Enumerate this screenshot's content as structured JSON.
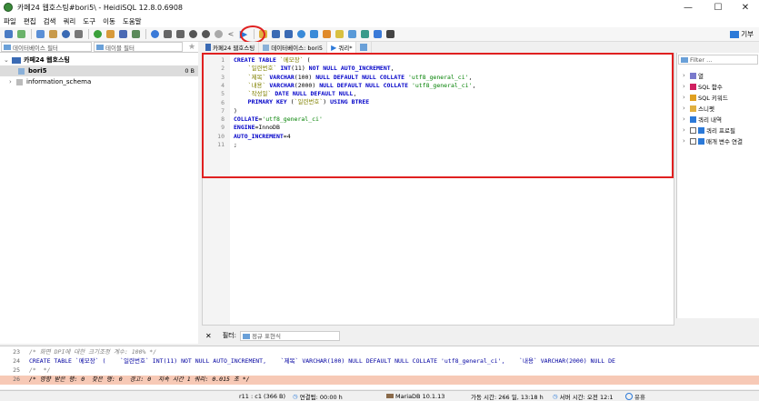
{
  "window": {
    "title": "카페24 웹호스팅#bori5\\ - HeidiSQL 12.8.0.6908",
    "minimize": "—",
    "maximize": "☐",
    "close": "✕"
  },
  "menu": [
    "파일",
    "편집",
    "검색",
    "쿼리",
    "도구",
    "이동",
    "도움말"
  ],
  "help_label": "기부",
  "db_filter_placeholder": "데이터베이스 필터",
  "table_filter_placeholder": "테이블 필터",
  "tree": {
    "root": "카페24 웹호스팅",
    "items": [
      {
        "name": "bori5",
        "size": "0 B",
        "selected": true
      },
      {
        "name": "information_schema",
        "size": "",
        "selected": false
      }
    ]
  },
  "tabs": [
    {
      "label": "카페24 웹호스팅"
    },
    {
      "label": "데이터베이스: bori5"
    },
    {
      "label": "쿼리*"
    }
  ],
  "editor": {
    "line_numbers": [
      "1",
      "2",
      "3",
      "4",
      "5",
      "6",
      "7",
      "8",
      "9",
      "10",
      "11"
    ],
    "lines": [
      [
        {
          "t": "kw",
          "v": "CREATE TABLE "
        },
        {
          "t": "idt",
          "v": "`메모장`"
        },
        {
          "t": "",
          "v": " ("
        }
      ],
      [
        {
          "t": "",
          "v": "    "
        },
        {
          "t": "idt",
          "v": "`일련번호`"
        },
        {
          "t": "",
          "v": " "
        },
        {
          "t": "kw",
          "v": "INT"
        },
        {
          "t": "",
          "v": "(11) "
        },
        {
          "t": "kw",
          "v": "NOT NULL AUTO_INCREMENT"
        },
        {
          "t": "",
          "v": ","
        }
      ],
      [
        {
          "t": "",
          "v": "    "
        },
        {
          "t": "idt",
          "v": "`제목`"
        },
        {
          "t": "",
          "v": " "
        },
        {
          "t": "kw",
          "v": "VARCHAR"
        },
        {
          "t": "",
          "v": "(100) "
        },
        {
          "t": "kw",
          "v": "NULL DEFAULT NULL COLLATE "
        },
        {
          "t": "str",
          "v": "'utf8_general_ci'"
        },
        {
          "t": "",
          "v": ","
        }
      ],
      [
        {
          "t": "",
          "v": "    "
        },
        {
          "t": "idt",
          "v": "`내용`"
        },
        {
          "t": "",
          "v": " "
        },
        {
          "t": "kw",
          "v": "VARCHAR"
        },
        {
          "t": "",
          "v": "(2000) "
        },
        {
          "t": "kw",
          "v": "NULL DEFAULT NULL COLLATE "
        },
        {
          "t": "str",
          "v": "'utf8_general_ci'"
        },
        {
          "t": "",
          "v": ","
        }
      ],
      [
        {
          "t": "",
          "v": "    "
        },
        {
          "t": "idt",
          "v": "`작성일`"
        },
        {
          "t": "",
          "v": " "
        },
        {
          "t": "kw",
          "v": "DATE NULL DEFAULT NULL"
        },
        {
          "t": "",
          "v": ","
        }
      ],
      [
        {
          "t": "",
          "v": "    "
        },
        {
          "t": "kw",
          "v": "PRIMARY KEY"
        },
        {
          "t": "",
          "v": " ("
        },
        {
          "t": "idt",
          "v": "`일련번호`"
        },
        {
          "t": "",
          "v": ") "
        },
        {
          "t": "kw",
          "v": "USING BTREE"
        }
      ],
      [
        {
          "t": "",
          "v": ")"
        }
      ],
      [
        {
          "t": "kw",
          "v": "COLLATE"
        },
        {
          "t": "",
          "v": "="
        },
        {
          "t": "str",
          "v": "'utf8_general_ci'"
        }
      ],
      [
        {
          "t": "kw",
          "v": "ENGINE"
        },
        {
          "t": "",
          "v": "=InnoDB"
        }
      ],
      [
        {
          "t": "kw",
          "v": "AUTO_INCREMENT"
        },
        {
          "t": "",
          "v": "=4"
        }
      ],
      [
        {
          "t": "",
          "v": ";"
        }
      ]
    ]
  },
  "right_panel": [
    {
      "label": "열",
      "icon": "columns-icon",
      "checkbox": false
    },
    {
      "label": "SQL 함수",
      "icon": "function-icon",
      "checkbox": false
    },
    {
      "label": "SQL 키워드",
      "icon": "key-icon",
      "checkbox": false
    },
    {
      "label": "스니펫",
      "icon": "folder-icon",
      "checkbox": false
    },
    {
      "label": "쿼리 내역",
      "icon": "history-icon",
      "checkbox": false
    },
    {
      "label": "쿼리 프로필",
      "icon": "profile-icon",
      "checkbox": true
    },
    {
      "label": "매개 변수 연결",
      "icon": "param-icon",
      "checkbox": true
    }
  ],
  "right_filter_placeholder": "Filter ...",
  "bottom_filter": {
    "label": "필터:",
    "placeholder": "정규 표현식"
  },
  "log": [
    {
      "n": "23",
      "text": "/* 화면 DPI에 대한 크기조정 계수: 100% */",
      "style": "comment"
    },
    {
      "n": "24",
      "text": "CREATE TABLE `메모장` (    `일련번호` INT(11) NOT NULL AUTO_INCREMENT,    `제목` VARCHAR(100) NULL DEFAULT NULL COLLATE 'utf8_general_ci',    `내용` VARCHAR(2000) NULL DE",
      "style": "sql"
    },
    {
      "n": "25",
      "text": "/*  */",
      "style": "comment"
    },
    {
      "n": "26",
      "text": "/* 영향 받은 행: 0  찾은 행: 0  경고: 0  지속 시간 1 쿼리: 0.015 초 */",
      "style": "highlight"
    }
  ],
  "status": {
    "position": "r11 : c1 (366 B)",
    "connected": "연결됨: 00:00 h",
    "server": "MariaDB 10.1.13",
    "uptime": "가동 시간: 266 일, 13:18 h",
    "server_time": "서버 시간: 오전 12:1",
    "idle": "유휴"
  },
  "colors": {
    "accent": "#2b79d8",
    "highlight_box": "#e02020",
    "log_highlight": "#f7c9b6"
  }
}
